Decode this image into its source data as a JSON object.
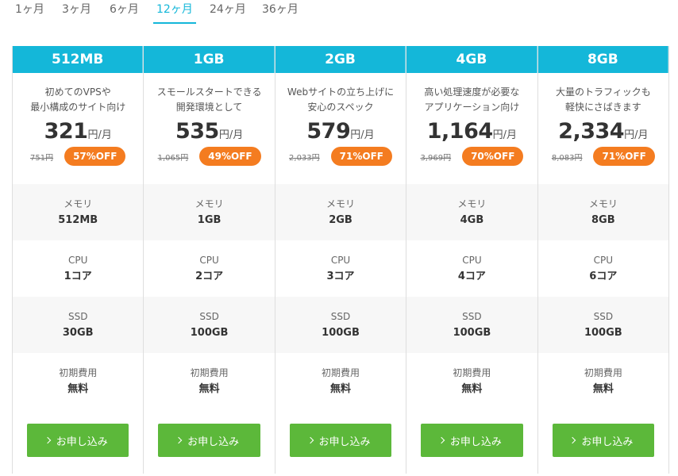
{
  "tabs": [
    {
      "label": "1ヶ月",
      "active": false
    },
    {
      "label": "3ヶ月",
      "active": false
    },
    {
      "label": "6ヶ月",
      "active": false
    },
    {
      "label": "12ヶ月",
      "active": true
    },
    {
      "label": "24ヶ月",
      "active": false
    },
    {
      "label": "36ヶ月",
      "active": false
    }
  ],
  "spec_labels": {
    "memory": "メモリ",
    "cpu": "CPU",
    "ssd": "SSD",
    "setup": "初期費用"
  },
  "price_unit": "円/月",
  "cta_label": "お申し込み",
  "colors": {
    "header": "#14b7d9",
    "badge": "#f47c20",
    "cta": "#5cb83a",
    "active_tab": "#14b7d9"
  },
  "icons": {
    "cta": "chevron-right-icon"
  },
  "plans": [
    {
      "name": "512MB",
      "desc_line1": "初めてのVPSや",
      "desc_line2": "最小構成のサイト向け",
      "price": "321",
      "old_price": "751円",
      "discount": "57%OFF",
      "memory": "512MB",
      "cpu": "1コア",
      "ssd": "30GB",
      "setup": "無料"
    },
    {
      "name": "1GB",
      "desc_line1": "スモールスタートできる",
      "desc_line2": "開発環境として",
      "price": "535",
      "old_price": "1,065円",
      "discount": "49%OFF",
      "memory": "1GB",
      "cpu": "2コア",
      "ssd": "100GB",
      "setup": "無料"
    },
    {
      "name": "2GB",
      "desc_line1": "Webサイトの立ち上げに",
      "desc_line2": "安心のスペック",
      "price": "579",
      "old_price": "2,033円",
      "discount": "71%OFF",
      "memory": "2GB",
      "cpu": "3コア",
      "ssd": "100GB",
      "setup": "無料"
    },
    {
      "name": "4GB",
      "desc_line1": "高い処理速度が必要な",
      "desc_line2": "アプリケーション向け",
      "price": "1,164",
      "old_price": "3,969円",
      "discount": "70%OFF",
      "memory": "4GB",
      "cpu": "4コア",
      "ssd": "100GB",
      "setup": "無料"
    },
    {
      "name": "8GB",
      "desc_line1": "大量のトラフィックも",
      "desc_line2": "軽快にさばきます",
      "price": "2,334",
      "old_price": "8,083円",
      "discount": "71%OFF",
      "memory": "8GB",
      "cpu": "6コア",
      "ssd": "100GB",
      "setup": "無料"
    }
  ]
}
